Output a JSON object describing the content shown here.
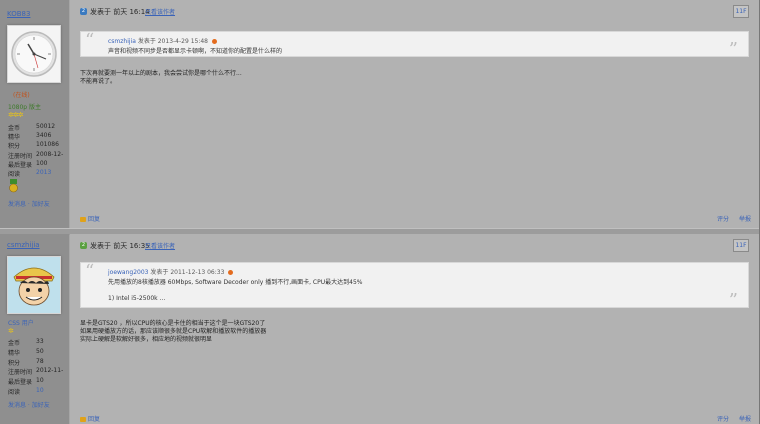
{
  "post1": {
    "username": "KOB83",
    "user_title": "1080p 版主",
    "online_text": "(在线)",
    "stars": "✲✲✲",
    "stats": [
      {
        "label": "金币",
        "value": "50012"
      },
      {
        "label": "精华",
        "value": "3406"
      },
      {
        "label": "积分",
        "value": "101086"
      },
      {
        "label": "注册时间",
        "value": "2008-12-"
      },
      {
        "label": "最后登录",
        "value": "100"
      },
      {
        "label": "阅读",
        "value": "2013"
      }
    ],
    "user_links": "发消息 · 加好友",
    "posted": "发表于 前天 16:14",
    "only_author": "只看该作者",
    "floor": "11F",
    "quote_author": "csmzhijia",
    "quote_meta": "发表于 2013-4-29 15:48",
    "quote_text": "声音和视频不同步是否都显示卡顿啊，不知道你的配置是什么样的",
    "body_lines": [
      "下次再就要测一年以上的剧本，我会尝试你是哪个什么不行...",
      "不能再说了。"
    ],
    "reply": "回复",
    "actions": [
      "评分",
      "举报"
    ]
  },
  "post2": {
    "username": "csmzhijia",
    "user_title": "CSS 用户",
    "stars": "✲",
    "stats": [
      {
        "label": "金币",
        "value": "33"
      },
      {
        "label": "精华",
        "value": "50"
      },
      {
        "label": "积分",
        "value": "78"
      },
      {
        "label": "注册时间",
        "value": "2012-11-"
      },
      {
        "label": "最后登录",
        "value": "10"
      },
      {
        "label": "阅读",
        "value": "10"
      }
    ],
    "user_links": "发消息 · 加好友",
    "posted": "发表于 前天 16:35",
    "only_author": "只看该作者",
    "floor": "11F",
    "quote_author": "joewang2003",
    "quote_meta": "发表于 2011-12-13 06:33",
    "quote_text": "先用播放的8核播放器 60Mbps, Software Decoder only 播到不行,画面卡, CPU最大达到45%",
    "quote_text2": "1) Intel i5-2500k ...",
    "body_lines": [
      "显卡是GTS20 ，所以CPU的核心是卡住的相当于这个是一块GTS20了",
      "如果用硬播放方的话，那应该顺很多就是CPU软解和播放软件的播放器",
      "实际上硬解是软解好很多，相应地的视频就很明显"
    ],
    "reply": "回复",
    "actions": [
      "评分",
      "举报"
    ]
  }
}
